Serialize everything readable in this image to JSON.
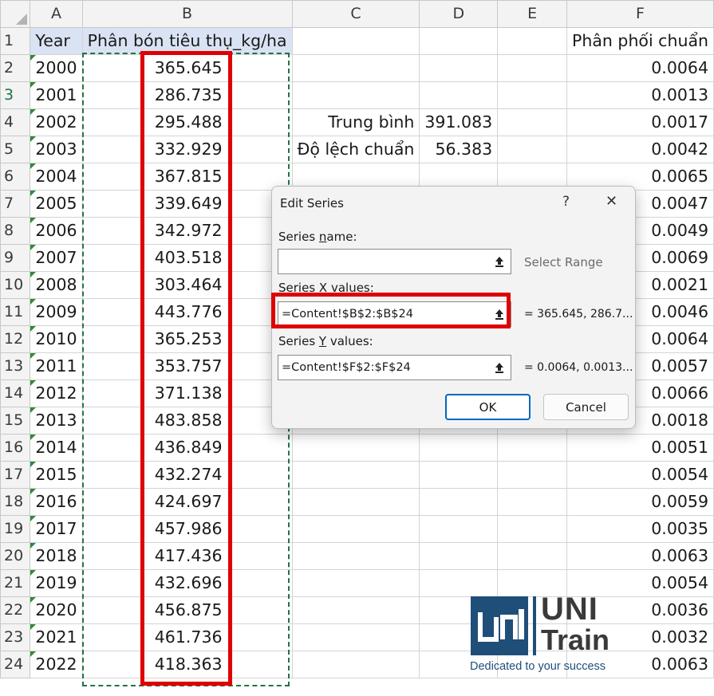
{
  "columns": [
    "A",
    "B",
    "C",
    "D",
    "E",
    "F"
  ],
  "row_numbers": [
    "1",
    "2",
    "3",
    "4",
    "5",
    "6",
    "7",
    "8",
    "9",
    "10",
    "11",
    "12",
    "13",
    "14",
    "15",
    "16",
    "17",
    "18",
    "19",
    "20",
    "21",
    "22",
    "23",
    "24"
  ],
  "header_row": {
    "a": "Year",
    "b": "Phân bón tiêu thụ_kg/ha",
    "f": "Phân phối chuẩn"
  },
  "rows": [
    {
      "year": "2000",
      "value": "365.645",
      "f": "0.0064"
    },
    {
      "year": "2001",
      "value": "286.735",
      "f": "0.0013"
    },
    {
      "year": "2002",
      "value": "295.488",
      "f": "0.0017"
    },
    {
      "year": "2003",
      "value": "332.929",
      "f": "0.0042"
    },
    {
      "year": "2004",
      "value": "367.815",
      "f": "0.0065"
    },
    {
      "year": "2005",
      "value": "339.649",
      "f": "0.0047"
    },
    {
      "year": "2006",
      "value": "342.972",
      "f": "0.0049"
    },
    {
      "year": "2007",
      "value": "403.518",
      "f": "0.0069"
    },
    {
      "year": "2008",
      "value": "303.464",
      "f": "0.0021"
    },
    {
      "year": "2009",
      "value": "443.776",
      "f": "0.0046"
    },
    {
      "year": "2010",
      "value": "365.253",
      "f": "0.0064"
    },
    {
      "year": "2011",
      "value": "353.757",
      "f": "0.0057"
    },
    {
      "year": "2012",
      "value": "371.138",
      "f": "0.0066"
    },
    {
      "year": "2013",
      "value": "483.858",
      "f": "0.0018"
    },
    {
      "year": "2014",
      "value": "436.849",
      "f": "0.0051"
    },
    {
      "year": "2015",
      "value": "432.274",
      "f": "0.0054"
    },
    {
      "year": "2016",
      "value": "424.697",
      "f": "0.0059"
    },
    {
      "year": "2017",
      "value": "457.986",
      "f": "0.0035"
    },
    {
      "year": "2018",
      "value": "417.436",
      "f": "0.0063"
    },
    {
      "year": "2019",
      "value": "432.696",
      "f": "0.0054"
    },
    {
      "year": "2020",
      "value": "456.875",
      "f": "0.0036"
    },
    {
      "year": "2021",
      "value": "461.736",
      "f": "0.0032"
    },
    {
      "year": "2022",
      "value": "418.363",
      "f": "0.0063"
    }
  ],
  "stats": {
    "mean_label": "Trung bình",
    "mean_value": "391.083",
    "std_label": "Độ lệch chuẩn",
    "std_value": "56.383"
  },
  "dialog": {
    "title": "Edit Series",
    "help": "?",
    "close": "✕",
    "series_name_label": "Series name:",
    "series_name_value": "",
    "select_range": "Select Range",
    "x_label": "Series X values:",
    "x_value": "=Content!$B$2:$B$24",
    "x_preview": "= 365.645, 286.7...",
    "y_label": "Series Y values:",
    "y_value": "=Content!$F$2:$F$24",
    "y_preview": "= 0.0064, 0.0013...",
    "ok": "OK",
    "cancel": "Cancel"
  },
  "logo": {
    "brand_top": "UNI",
    "brand_bottom": "Train",
    "tagline": "Dedicated to your success"
  },
  "colors": {
    "highlight_red": "#e00000",
    "excel_green": "#217346",
    "header_fill": "#dae3f3",
    "logo_blue": "#1f4e79"
  }
}
